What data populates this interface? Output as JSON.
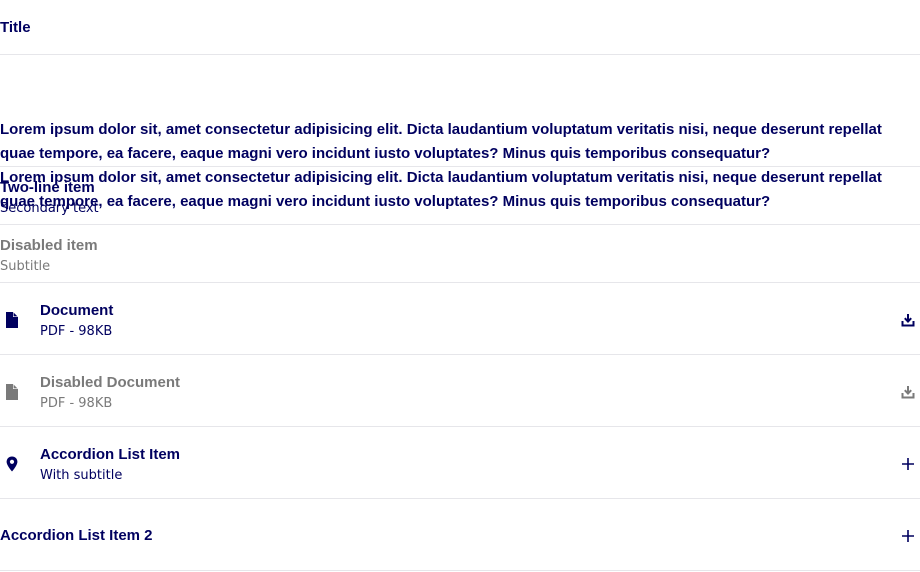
{
  "title": "Title",
  "paragraph": [
    "Lorem ipsum dolor sit, amet consectetur adipisicing elit. Dicta laudantium voluptatum veritatis nisi, neque deserunt repellat quae tempore, ea facere, eaque magni vero incidunt iusto voluptates? Minus quis temporibus consequatur?",
    "Lorem ipsum dolor sit, amet consectetur adipisicing elit. Dicta laudantium voluptatum veritatis nisi, neque deserunt repellat quae tempore, ea facere, eaque magni vero incidunt iusto voluptates? Minus quis temporibus consequatur?"
  ],
  "items": {
    "two_line": {
      "primary": "Two-line item",
      "secondary": "Secondary text"
    },
    "disabled": {
      "primary": "Disabled item",
      "secondary": "Subtitle"
    },
    "document": {
      "primary": "Document",
      "secondary": "PDF - 98KB",
      "icon": "file-icon",
      "action_icon": "download-icon"
    },
    "disabled_document": {
      "primary": "Disabled Document",
      "secondary": "PDF - 98KB",
      "icon": "file-icon",
      "action_icon": "download-icon"
    },
    "accordion_1": {
      "primary": "Accordion List Item",
      "secondary": "With subtitle",
      "icon": "location-pin-icon",
      "action_icon": "plus-icon"
    },
    "accordion_2": {
      "primary": "Accordion List Item 2",
      "action_icon": "plus-icon"
    }
  },
  "colors": {
    "primary_text": "#00005f",
    "disabled_text": "#7a7a7a",
    "divider": "#e6e6ea"
  }
}
